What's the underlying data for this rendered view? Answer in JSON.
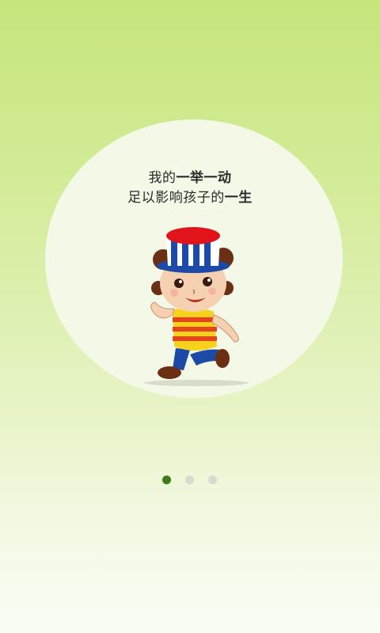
{
  "slogan": {
    "line1_prefix": "我的",
    "line1_emphasis": "一举一动",
    "line2_prefix": "足以影响孩子的",
    "line2_emphasis": "一生"
  },
  "illustration": {
    "icon": "running-mascot-icon"
  },
  "pager": {
    "total": 3,
    "active_index": 0,
    "active_color": "#3f7a1b",
    "inactive_color": "#d8dbd2"
  },
  "colors": {
    "background_top": "#c6e57c",
    "background_bottom": "#fafdf4",
    "circle": "#f3f9e6"
  }
}
